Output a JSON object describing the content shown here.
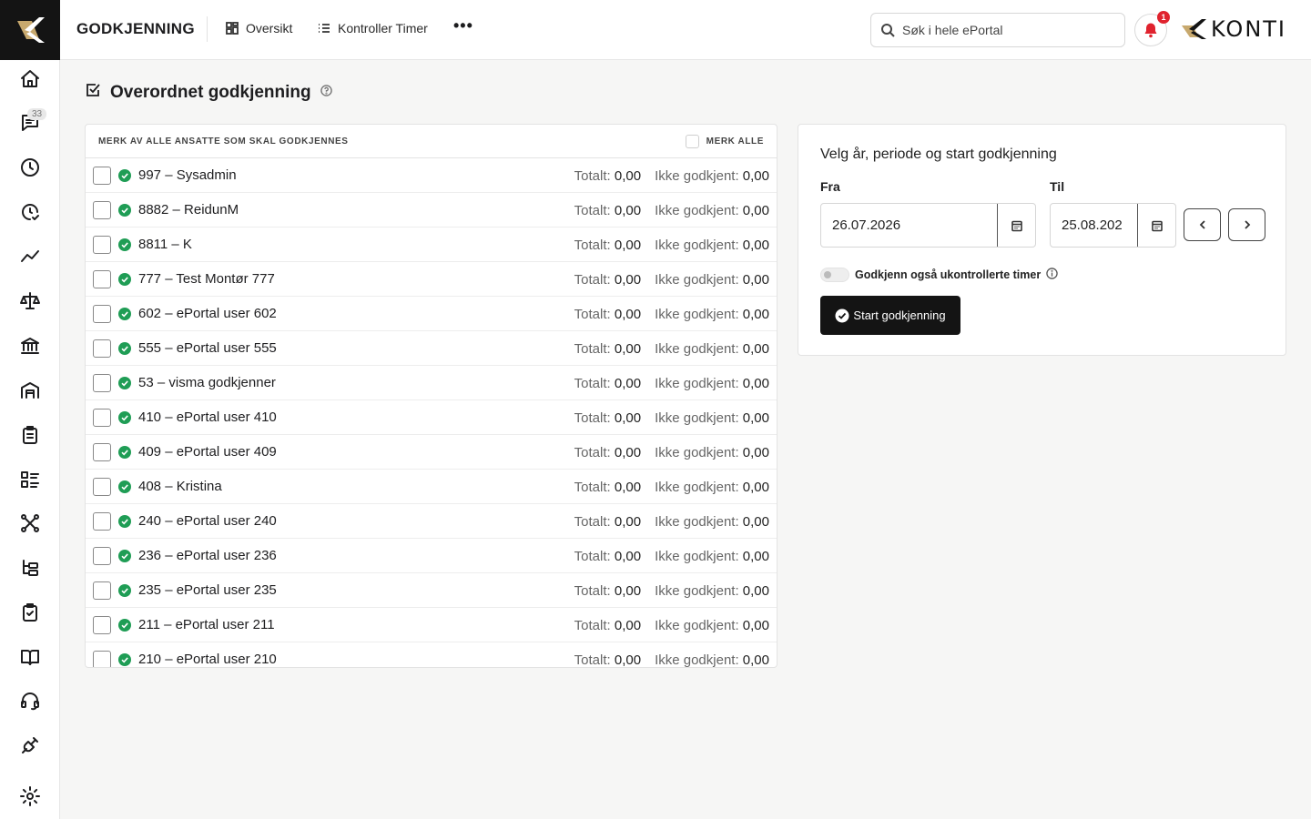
{
  "header": {
    "module_title": "GODKJENNING",
    "tabs": [
      {
        "label": "Oversikt",
        "icon": "grid-icon"
      },
      {
        "label": "Kontroller Timer",
        "icon": "list-icon"
      }
    ],
    "more_label": "•••",
    "search_placeholder": "Søk i hele ePortal",
    "notification_count": "1",
    "brand": "KONTI"
  },
  "sidebar": {
    "messages_badge": "33",
    "items": [
      "home-icon",
      "messages-icon",
      "clock-icon",
      "clock-check-icon",
      "trend-icon",
      "scale-icon",
      "bank-icon",
      "warehouse-icon",
      "clipboard-icon",
      "checklist-icon",
      "network-icon",
      "tree-icon",
      "clipboard-check-icon",
      "book-icon",
      "headset-icon",
      "plug-icon",
      "settings-icon"
    ]
  },
  "page": {
    "title": "Overordnet godkjenning"
  },
  "employees": {
    "hint": "MERK AV ALLE ANSATTE SOM SKAL GODKJENNES",
    "mark_all_label": "MERK ALLE",
    "total_label": "Totalt:",
    "unapproved_label": "Ikke godkjent:",
    "rows": [
      {
        "name": "997 – Sysadmin",
        "total": "0,00",
        "unapproved": "0,00"
      },
      {
        "name": "8882 – ReidunM",
        "total": "0,00",
        "unapproved": "0,00"
      },
      {
        "name": "8811 – K",
        "total": "0,00",
        "unapproved": "0,00"
      },
      {
        "name": "777 – Test Montør 777",
        "total": "0,00",
        "unapproved": "0,00"
      },
      {
        "name": "602 – ePortal user 602",
        "total": "0,00",
        "unapproved": "0,00"
      },
      {
        "name": "555 – ePortal user 555",
        "total": "0,00",
        "unapproved": "0,00"
      },
      {
        "name": "53 – visma godkjenner",
        "total": "0,00",
        "unapproved": "0,00"
      },
      {
        "name": "410 – ePortal user 410",
        "total": "0,00",
        "unapproved": "0,00"
      },
      {
        "name": "409 – ePortal user 409",
        "total": "0,00",
        "unapproved": "0,00"
      },
      {
        "name": "408 – Kristina",
        "total": "0,00",
        "unapproved": "0,00"
      },
      {
        "name": "240 – ePortal user 240",
        "total": "0,00",
        "unapproved": "0,00"
      },
      {
        "name": "236 – ePortal user 236",
        "total": "0,00",
        "unapproved": "0,00"
      },
      {
        "name": "235 – ePortal user 235",
        "total": "0,00",
        "unapproved": "0,00"
      },
      {
        "name": "211 – ePortal user 211",
        "total": "0,00",
        "unapproved": "0,00"
      },
      {
        "name": "210 – ePortal user 210",
        "total": "0,00",
        "unapproved": "0,00"
      }
    ]
  },
  "approval": {
    "heading": "Velg år, periode og start godkjenning",
    "from_label": "Fra",
    "from_value": "26.07.2026",
    "to_label": "Til",
    "to_value": "25.08.202",
    "toggle_label": "Godkjenn også ukontrollerte timer",
    "toggle_on": false,
    "start_label": "Start godkjenning"
  },
  "colors": {
    "accent_dark": "#141414",
    "brand_gold": "#c8a96e",
    "ok_green": "#1f9d55",
    "alert_red": "#e0232e"
  }
}
